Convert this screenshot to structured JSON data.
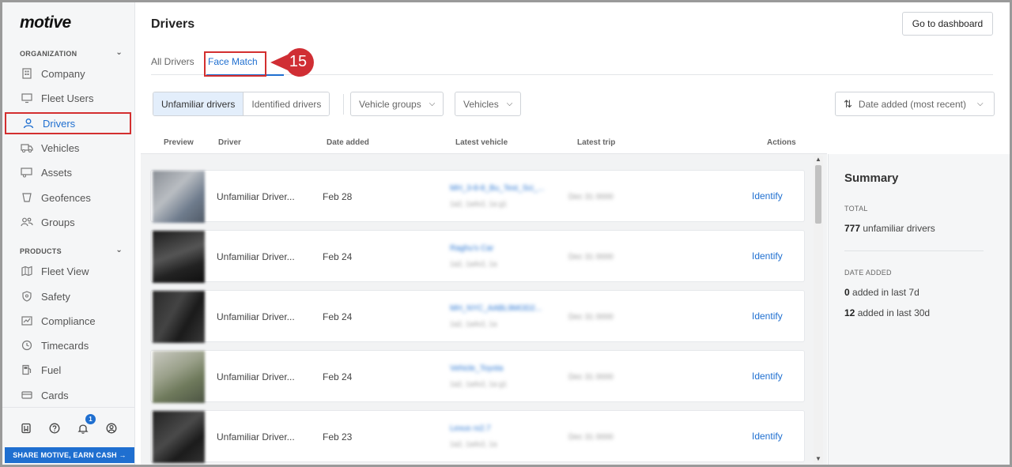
{
  "brand": {
    "logo": "motive"
  },
  "sidebar": {
    "organization_label": "ORGANIZATION",
    "products_label": "PRODUCTS",
    "org_items": [
      {
        "label": "Company",
        "icon": "building-icon"
      },
      {
        "label": "Fleet Users",
        "icon": "monitor-icon"
      },
      {
        "label": "Drivers",
        "icon": "person-icon",
        "active": true
      },
      {
        "label": "Vehicles",
        "icon": "truck-icon"
      },
      {
        "label": "Assets",
        "icon": "trailer-icon"
      },
      {
        "label": "Geofences",
        "icon": "geofence-icon"
      },
      {
        "label": "Groups",
        "icon": "groups-icon"
      }
    ],
    "product_items": [
      {
        "label": "Fleet View",
        "icon": "map-icon"
      },
      {
        "label": "Safety",
        "icon": "shield-icon"
      },
      {
        "label": "Compliance",
        "icon": "compliance-icon"
      },
      {
        "label": "Timecards",
        "icon": "clock-icon"
      },
      {
        "label": "Fuel",
        "icon": "fuel-icon"
      },
      {
        "label": "Cards",
        "icon": "card-icon"
      }
    ],
    "notification_count": "1",
    "share_banner": "SHARE MOTIVE, EARN CASH →"
  },
  "header": {
    "title": "Drivers",
    "dashboard_button": "Go to dashboard"
  },
  "tabs": [
    {
      "label": "All Drivers",
      "active": false
    },
    {
      "label": "Face Match",
      "active": true
    }
  ],
  "callout": {
    "number": "15"
  },
  "filters": {
    "segment": [
      {
        "label": "Unfamiliar drivers",
        "active": true
      },
      {
        "label": "Identified drivers",
        "active": false
      }
    ],
    "vehicle_groups": "Vehicle groups",
    "vehicles": "Vehicles",
    "sort": "Date added (most recent)"
  },
  "table": {
    "columns": [
      "Preview",
      "Driver",
      "Date added",
      "Latest vehicle",
      "Latest trip",
      "Actions"
    ],
    "rows": [
      {
        "driver": "Unfamiliar Driver...",
        "date_added": "Feb 28",
        "vehicle": "MH_3-8-8_Bu_Test_Sci_...",
        "vehicle_sub": "1a2, 1a4v2, 1a g1",
        "trip": "Dec 31 0000",
        "action": "Identify"
      },
      {
        "driver": "Unfamiliar Driver...",
        "date_added": "Feb 24",
        "vehicle": "Raghu's Car",
        "vehicle_sub": "1a2, 1a4v2, 1a",
        "trip": "Dec 31 0000",
        "action": "Identify"
      },
      {
        "driver": "Unfamiliar Driver...",
        "date_added": "Feb 24",
        "vehicle": "MH_NYC_AABL9MOD2...",
        "vehicle_sub": "1a2, 1a4v2, 1a",
        "trip": "Dec 31 0000",
        "action": "Identify"
      },
      {
        "driver": "Unfamiliar Driver...",
        "date_added": "Feb 24",
        "vehicle": "Vehicle_Toyota",
        "vehicle_sub": "1a2, 1a4v2, 1a g1",
        "trip": "Dec 31 0000",
        "action": "Identify"
      },
      {
        "driver": "Unfamiliar Driver...",
        "date_added": "Feb 23",
        "vehicle": "Lexus rx2.7",
        "vehicle_sub": "1a2, 1a4v2, 1a",
        "trip": "Dec 31 0000",
        "action": "Identify"
      }
    ]
  },
  "summary": {
    "title": "Summary",
    "total_label": "TOTAL",
    "total_count": "777",
    "total_suffix": "unfamiliar drivers",
    "date_added_label": "DATE ADDED",
    "last7_count": "0",
    "last7_suffix": "added in last 7d",
    "last30_count": "12",
    "last30_suffix": "added in last 30d"
  },
  "colors": {
    "accent": "#1f6fd0",
    "highlight": "#d32f2f"
  }
}
